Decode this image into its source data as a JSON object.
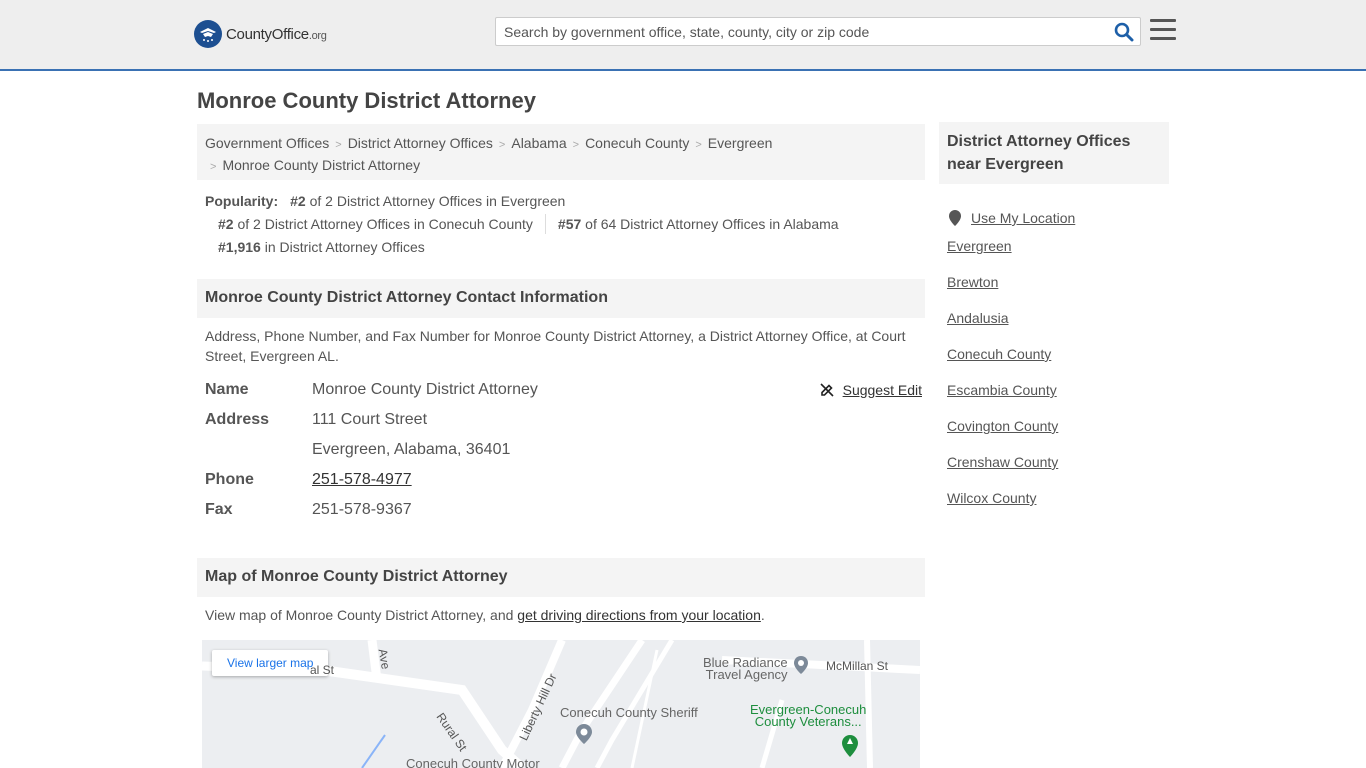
{
  "header": {
    "logo_main": "CountyOffice",
    "logo_tld": ".org",
    "search_placeholder": "Search by government office, state, county, city or zip code"
  },
  "page_title": "Monroe County District Attorney",
  "breadcrumb": [
    "Government Offices",
    "District Attorney Offices",
    "Alabama",
    "Conecuh County",
    "Evergreen",
    "Monroe County District Attorney"
  ],
  "popularity": {
    "label": "Popularity:",
    "items": [
      {
        "rank": "#2",
        "text": "of 2 District Attorney Offices in Evergreen"
      },
      {
        "rank": "#2",
        "text": "of 2 District Attorney Offices in Conecuh County"
      },
      {
        "rank": "#57",
        "text": "of 64 District Attorney Offices in Alabama"
      },
      {
        "rank": "#1,916",
        "text": "in District Attorney Offices"
      }
    ]
  },
  "contact": {
    "heading": "Monroe County District Attorney Contact Information",
    "description": "Address, Phone Number, and Fax Number for Monroe County District Attorney, a District Attorney Office, at Court Street, Evergreen AL.",
    "suggest_edit": "Suggest Edit",
    "rows": {
      "name_label": "Name",
      "name_value": "Monroe County District Attorney",
      "address_label": "Address",
      "address_line1": "111 Court Street",
      "address_line2": "Evergreen, Alabama, 36401",
      "phone_label": "Phone",
      "phone_value": "251-578-4977",
      "fax_label": "Fax",
      "fax_value": "251-578-9367"
    }
  },
  "map": {
    "heading": "Map of Monroe County District Attorney",
    "description_prefix": "View map of Monroe County District Attorney, and ",
    "directions_link": "get driving directions from your location",
    "description_suffix": ".",
    "view_larger": "View larger map",
    "labels": {
      "st_left": "al St",
      "ave": "Ave",
      "rural_st": "Rural St",
      "liberty_hill": "Liberty Hill Dr",
      "mcmillan": "McMillan St",
      "blue_radiance_1": "Blue Radiance",
      "blue_radiance_2": "Travel Agency",
      "sheriff": "Conecuh County Sheriff",
      "veterans_1": "Evergreen-Conecuh",
      "veterans_2": "County Veterans...",
      "motor": "Conecuh County Motor"
    }
  },
  "sidebar": {
    "heading": "District Attorney Offices near Evergreen",
    "use_location": "Use My Location",
    "items": [
      "Evergreen",
      "Brewton",
      "Andalusia",
      "Conecuh County",
      "Escambia County",
      "Covington County",
      "Crenshaw County",
      "Wilcox County"
    ]
  },
  "colors": {
    "header_bg": "#eeeeee",
    "header_border": "#3a71b3",
    "logo_blue": "#1d4f91",
    "search_icon": "#1d5fa8"
  }
}
